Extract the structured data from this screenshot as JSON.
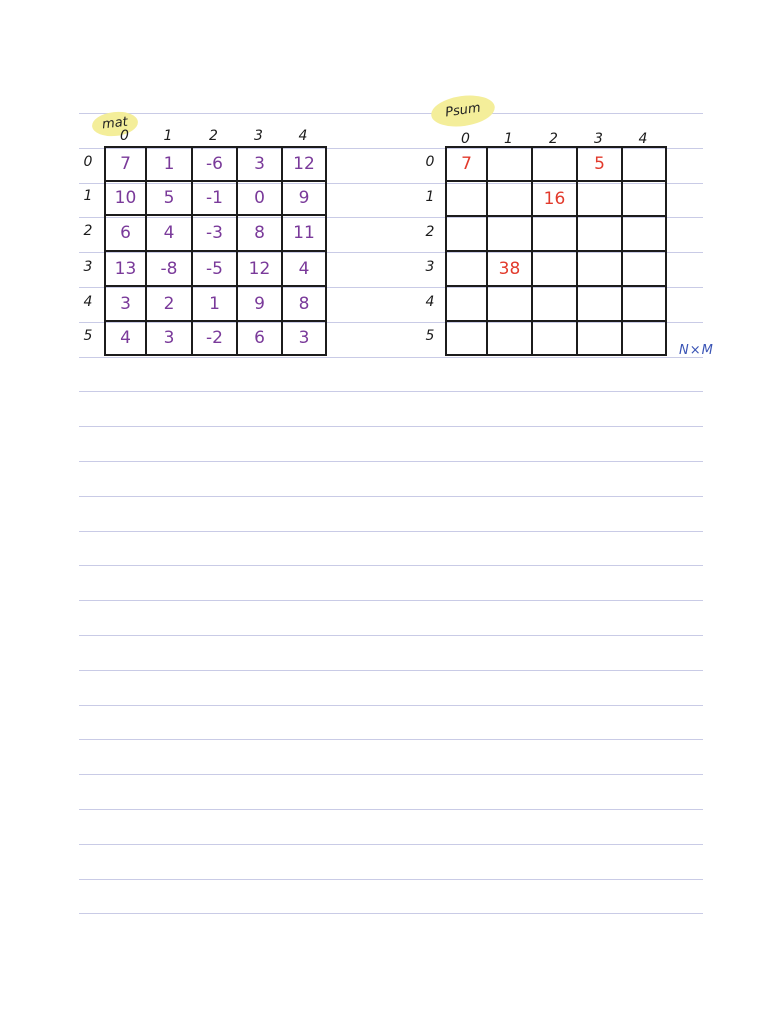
{
  "mat": {
    "label": "mat",
    "col_headers": [
      "0",
      "1",
      "2",
      "3",
      "4"
    ],
    "row_headers": [
      "0",
      "1",
      "2",
      "3",
      "4",
      "5"
    ],
    "rows": [
      [
        "7",
        "1",
        "-6",
        "3",
        "12"
      ],
      [
        "10",
        "5",
        "-1",
        "0",
        "9"
      ],
      [
        "6",
        "4",
        "-3",
        "8",
        "11"
      ],
      [
        "13",
        "-8",
        "-5",
        "12",
        "4"
      ],
      [
        "3",
        "2",
        "1",
        "9",
        "8"
      ],
      [
        "4",
        "3",
        "-2",
        "6",
        "3"
      ]
    ]
  },
  "psum": {
    "label": "Psum",
    "col_headers": [
      "0",
      "1",
      "2",
      "3",
      "4"
    ],
    "row_headers": [
      "0",
      "1",
      "2",
      "3",
      "4",
      "5"
    ],
    "rows": [
      [
        "7",
        "",
        "",
        "5",
        ""
      ],
      [
        "",
        "",
        "16",
        "",
        ""
      ],
      [
        "",
        "",
        "",
        "",
        ""
      ],
      [
        "",
        "38",
        "",
        "",
        ""
      ],
      [
        "",
        "",
        "",
        "",
        ""
      ],
      [
        "",
        "",
        "",
        "",
        ""
      ]
    ]
  },
  "note": "N×M",
  "colors": {
    "mat_values": "#7a3a9a",
    "psum_values": "#e23a2c",
    "highlight": "#f4ee9a",
    "note": "#3a54b5"
  }
}
